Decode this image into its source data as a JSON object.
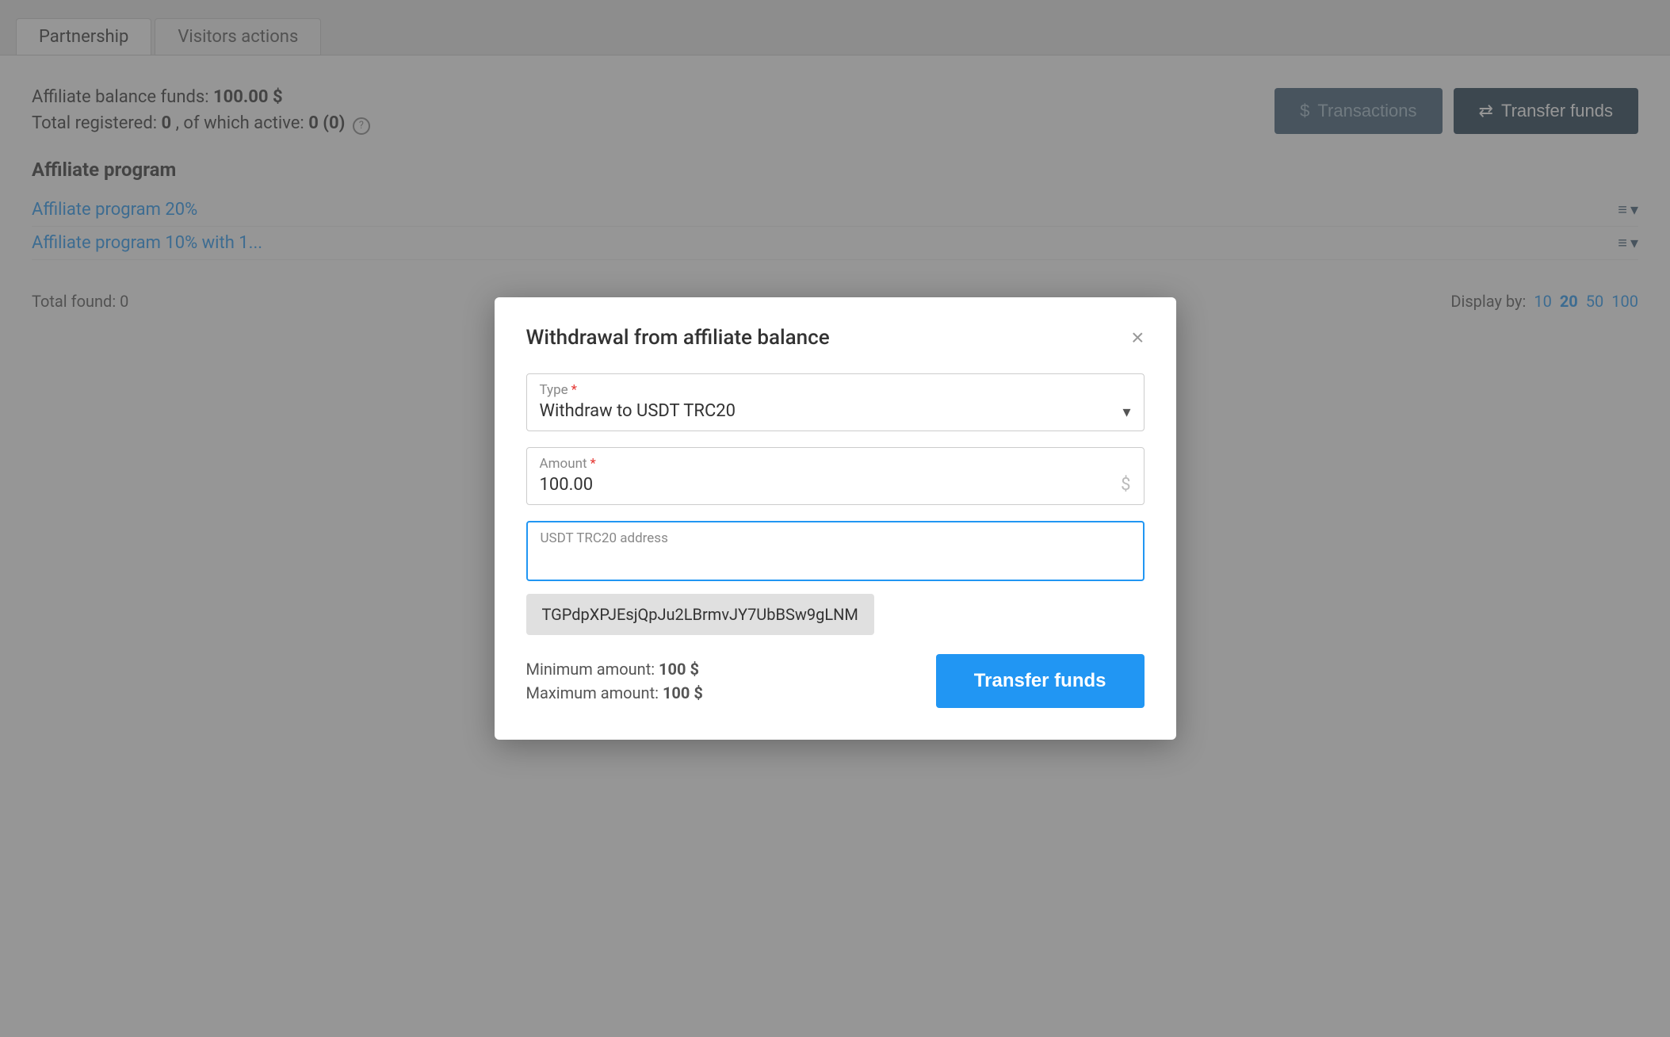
{
  "tabs": [
    {
      "label": "Partnership",
      "active": true
    },
    {
      "label": "Visitors actions",
      "active": false
    }
  ],
  "info": {
    "balance_label": "Affiliate balance funds:",
    "balance_value": "100.00 $",
    "registered_label": "Total registered:",
    "registered_value": "0",
    "active_label": ", of which active:",
    "active_value": "0 (0)"
  },
  "buttons": {
    "transactions": "Transactions",
    "transfer_funds": "Transfer funds"
  },
  "affiliate_section": {
    "title": "Affiliate program",
    "links": [
      "Affiliate program 20%",
      "Affiliate program 10% with 1..."
    ]
  },
  "pagination": {
    "total_found_label": "Total found:",
    "total_found_value": "0",
    "display_by_label": "Display by:",
    "options": [
      "10",
      "20",
      "50",
      "100"
    ],
    "active_option": "20"
  },
  "modal": {
    "title": "Withdrawal from affiliate balance",
    "close_label": "×",
    "type_label": "Type",
    "type_value": "Withdraw to USDT TRC20",
    "amount_label": "Amount",
    "amount_value": "100.00",
    "address_label": "USDT TRC20 address",
    "address_placeholder": "",
    "autocomplete_value": "TGPdpXPJEsjQpJu2LBrmvJY7UbBSw9gLNM",
    "min_amount_label": "Minimum amount:",
    "min_amount_value": "100 $",
    "max_amount_label": "Maximum amount:",
    "max_amount_value": "100 $",
    "transfer_button": "Transfer funds"
  }
}
